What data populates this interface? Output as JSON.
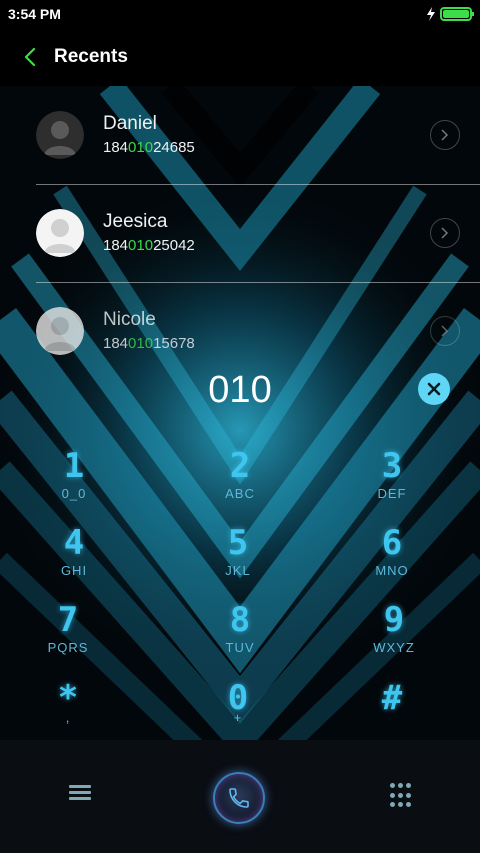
{
  "status_bar": {
    "time": "3:54 PM",
    "battery_level": 1.0
  },
  "header": {
    "title": "Recents"
  },
  "contacts": [
    {
      "name": "Daniel",
      "number_prefix": "184",
      "number_match": "010",
      "number_suffix": "24685",
      "avatar": "dark-person-avatar-icon"
    },
    {
      "name": "Jeesica",
      "number_prefix": "184",
      "number_match": "010",
      "number_suffix": "25042",
      "avatar": "person-avatar-icon"
    },
    {
      "name": "Nicole",
      "number_prefix": "184",
      "number_match": "010",
      "number_suffix": "15678",
      "avatar": "person-avatar-icon"
    }
  ],
  "dialer": {
    "input": "010",
    "keys": [
      {
        "digit": "1",
        "letters": "0_0"
      },
      {
        "digit": "2",
        "letters": "ABC"
      },
      {
        "digit": "3",
        "letters": "DEF"
      },
      {
        "digit": "4",
        "letters": "GHI"
      },
      {
        "digit": "5",
        "letters": "JKL"
      },
      {
        "digit": "6",
        "letters": "MNO"
      },
      {
        "digit": "7",
        "letters": "PQRS"
      },
      {
        "digit": "8",
        "letters": "TUV"
      },
      {
        "digit": "9",
        "letters": "WXYZ"
      },
      {
        "digit": "*",
        "letters": ","
      },
      {
        "digit": "0",
        "letters": "+"
      },
      {
        "digit": "#",
        "letters": ""
      }
    ]
  },
  "colors": {
    "accent": "#3fc6f0",
    "highlight": "#3ddc4a",
    "clear": "#5fd6f5"
  }
}
